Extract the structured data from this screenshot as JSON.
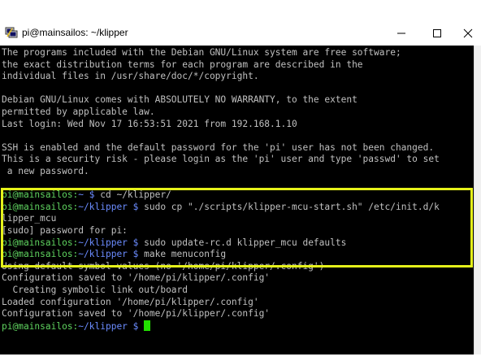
{
  "window": {
    "title": "pi@mainsailos: ~/klipper"
  },
  "terminal": {
    "motd": [
      "The programs included with the Debian GNU/Linux system are free software;",
      "the exact distribution terms for each program are described in the",
      "individual files in /usr/share/doc/*/copyright.",
      "",
      "Debian GNU/Linux comes with ABSOLUTELY NO WARRANTY, to the extent",
      "permitted by applicable law.",
      "Last login: Wed Nov 17 16:53:51 2021 from 192.168.1.10",
      "",
      "SSH is enabled and the default password for the 'pi' user has not been changed.",
      "This is a security risk - please login as the 'pi' user and type 'passwd' to set",
      " a new password.",
      ""
    ],
    "commands": [
      {
        "user": "pi@mainsailos",
        "sep": ":",
        "path": "~ $",
        "cmd": " cd ~/klipper/"
      },
      {
        "user": "pi@mainsailos",
        "sep": ":",
        "path": "~/klipper $",
        "cmd": " sudo cp \"./scripts/klipper-mcu-start.sh\" /etc/init.d/k"
      },
      {
        "text": "lipper_mcu"
      },
      {
        "text": "[sudo] password for pi:"
      },
      {
        "user": "pi@mainsailos",
        "sep": ":",
        "path": "~/klipper $",
        "cmd": " sudo update-rc.d klipper_mcu defaults"
      },
      {
        "user": "pi@mainsailos",
        "sep": ":",
        "path": "~/klipper $",
        "cmd": " make menuconfig"
      },
      {
        "text": "Using default symbol values (no '/home/pi/klipper/.config')"
      },
      {
        "text": "Configuration saved to '/home/pi/klipper/.config'"
      },
      {
        "text": "  Creating symbolic link out/board"
      },
      {
        "text": "Loaded configuration '/home/pi/klipper/.config'"
      },
      {
        "text": "Configuration saved to '/home/pi/klipper/.config'"
      },
      {
        "user": "pi@mainsailos",
        "sep": ":",
        "path": "~/klipper $",
        "cmd": " "
      }
    ]
  },
  "colors": {
    "prompt_user": "#5fd35f",
    "prompt_path": "#6b8cff",
    "cursor": "#22e000",
    "highlight": "#e5f21a",
    "text": "#c0c0c0"
  },
  "icons": [
    "putty-icon",
    "minimize-icon",
    "maximize-icon",
    "close-icon"
  ]
}
